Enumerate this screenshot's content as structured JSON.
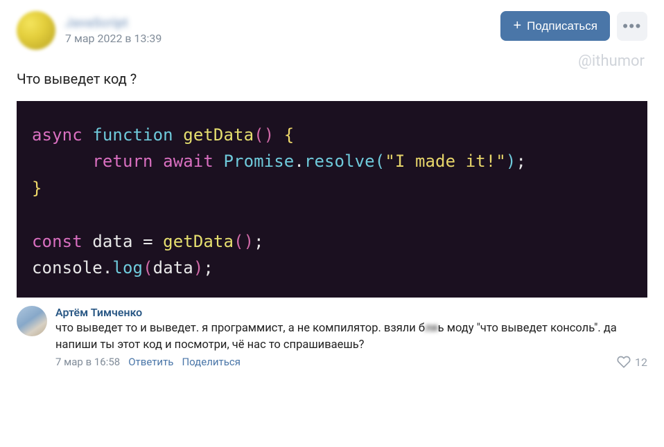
{
  "post": {
    "group_name": "JavaScript",
    "date": "7 мар 2022 в 13:39",
    "subscribe_label": "Подписаться",
    "text": "Что выведет код ?",
    "watermark": "@ithumor"
  },
  "code": {
    "line1_async": "async",
    "line1_function": "function",
    "line1_name": "getData",
    "line1_parens": "()",
    "line1_brace": " {",
    "line2_return": "return",
    "line2_await": "await",
    "line2_class": "Promise",
    "line2_dot": ".",
    "line2_method": "resolve",
    "line2_open": "(",
    "line2_str": "\"I made it!\"",
    "line2_close": ")",
    "line2_semi": ";",
    "line3_brace": "}",
    "line4_const": "const",
    "line4_var": "data",
    "line4_eq": " = ",
    "line4_name": "getData",
    "line4_parens": "()",
    "line4_semi": ";",
    "line5_console": "console",
    "line5_dot": ".",
    "line5_log": "log",
    "line5_open": "(",
    "line5_arg": "data",
    "line5_close": ")",
    "line5_semi": ";"
  },
  "comment": {
    "author": "Артём Тимченко",
    "text_prefix": "что выведет то и выведет. я программист, а не компилятор. взяли б",
    "text_censor": "ля",
    "text_suffix": "ь моду \"что выведет консоль\". да напиши ты этот код и посмотри, чё нас то спрашиваешь?",
    "date": "7 мар в 16:58",
    "reply": "Ответить",
    "share": "Поделиться",
    "likes": "12"
  }
}
